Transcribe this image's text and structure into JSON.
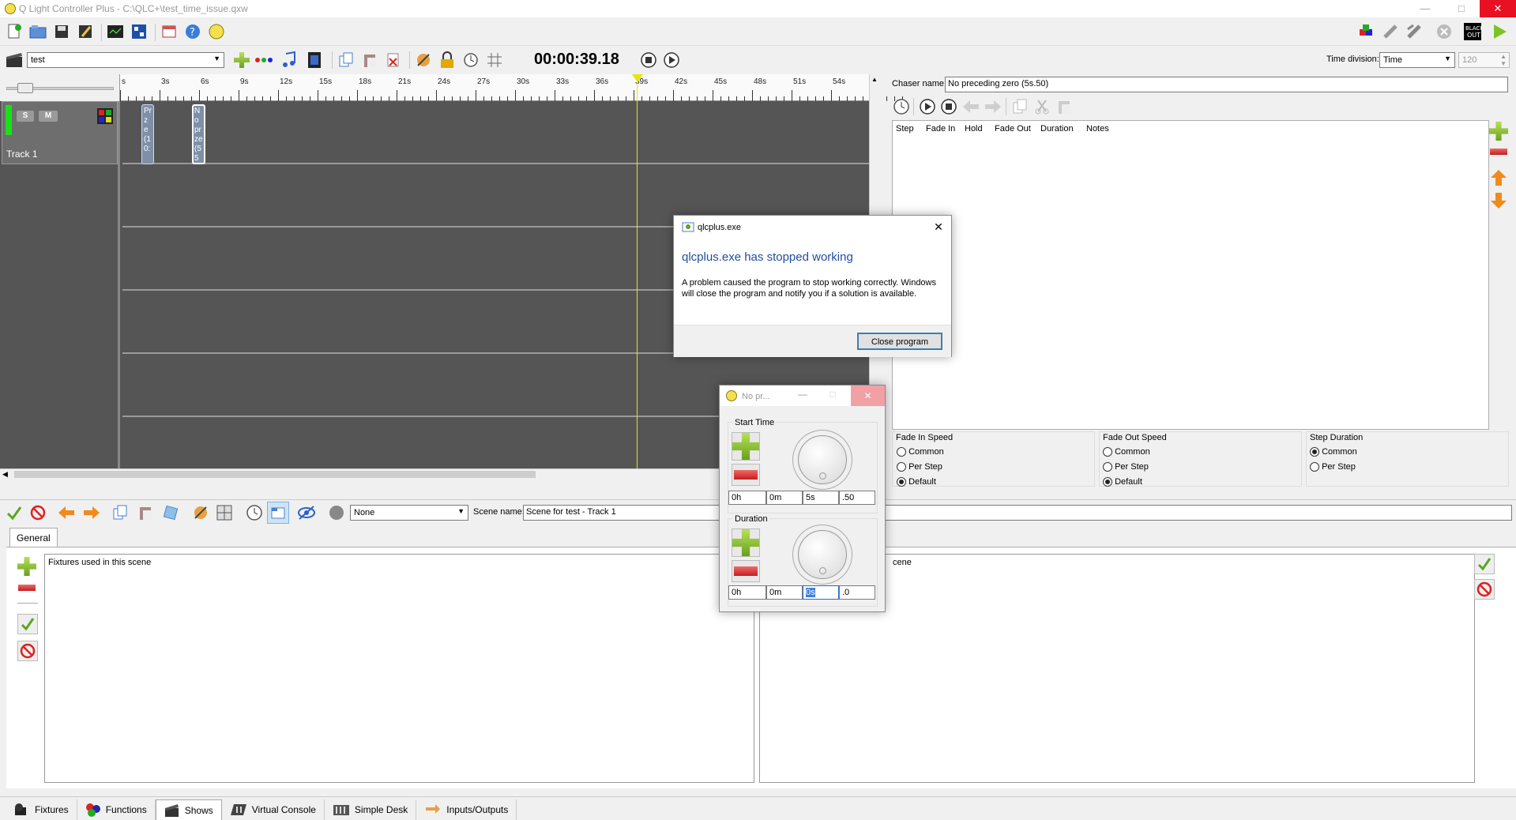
{
  "window": {
    "title": "Q Light Controller Plus - C:\\QLC+\\test_time_issue.qxw"
  },
  "show_toolbar": {
    "show_select": "test",
    "timer": "00:00:39.18",
    "time_division_label": "Time division:",
    "time_division_value": "Time",
    "bpm_value": "120"
  },
  "timeline": {
    "ruler_ticks": [
      "s",
      "3s",
      "6s",
      "9s",
      "12s",
      "15s",
      "18s",
      "21s",
      "24s",
      "27s",
      "30s",
      "33s",
      "36s",
      "39s",
      "42s",
      "45s",
      "48s",
      "51s",
      "54s",
      "5"
    ],
    "track_name": "Track 1",
    "solo_label": "S",
    "mute_label": "M",
    "item1_text": "Pr ze (1 0:",
    "item2_text": "No pr ze (5 50"
  },
  "chaser": {
    "name_label": "Chaser name",
    "name_value": "No preceding zero (5s.50)",
    "columns": [
      "Step",
      "Fade In",
      "Hold",
      "Fade Out",
      "Duration",
      "Notes"
    ],
    "fade_in_title": "Fade In Speed",
    "fade_out_title": "Fade Out Speed",
    "step_duration_title": "Step Duration",
    "opt_common": "Common",
    "opt_per_step": "Per Step",
    "opt_default": "Default"
  },
  "scene_editor": {
    "channels_group": "None",
    "scene_name_label": "Scene name:",
    "scene_name_value": "Scene for test - Track 1",
    "tab_general": "General",
    "fixtures_header": "Fixtures used in this scene",
    "right_header_fragment": "cene"
  },
  "crash_dialog": {
    "title": "qlcplus.exe",
    "heading": "qlcplus.exe has stopped working",
    "message": "A problem caused the program to stop working correctly. Windows will close the program and notify you if a solution is available.",
    "button": "Close program"
  },
  "speed_dialog": {
    "title": "No pr...",
    "start_time_label": "Start Time",
    "start_h": "0h",
    "start_m": "0m",
    "start_s": "5s",
    "start_ms": ".50",
    "duration_label": "Duration",
    "dur_h": "0h",
    "dur_m": "0m",
    "dur_s": "0s",
    "dur_ms": ".0"
  },
  "bottom_tabs": [
    "Fixtures",
    "Functions",
    "Shows",
    "Virtual Console",
    "Simple Desk",
    "Inputs/Outputs"
  ],
  "colors": {
    "timeline_bg": "#555555",
    "cursor": "#e5e510",
    "accent_blue": "#1f4e9e",
    "close_red": "#e81123"
  }
}
